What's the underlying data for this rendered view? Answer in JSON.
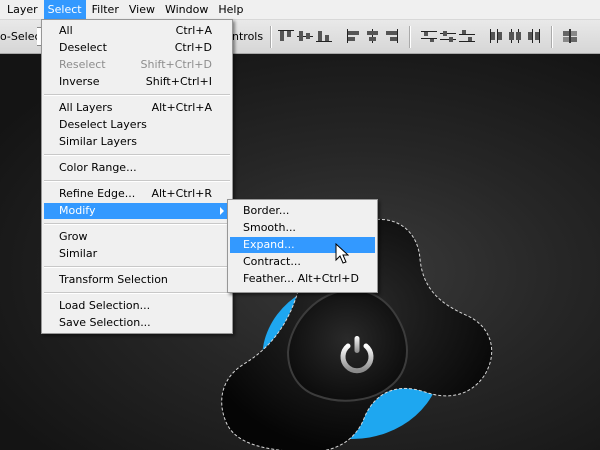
{
  "menubar": {
    "items": [
      "Layer",
      "Select",
      "Filter",
      "View",
      "Window",
      "Help"
    ],
    "active": "Select"
  },
  "options": {
    "autoselect_label": "o-Select:",
    "controls_label": "ntrols",
    "icons": [
      "align-top-icon",
      "align-vcenter-icon",
      "align-bottom-icon",
      "align-left-icon",
      "align-hcenter-icon",
      "align-right-icon",
      "distribute-top-icon",
      "distribute-vcenter-icon",
      "distribute-bottom-icon",
      "distribute-left-icon",
      "distribute-hcenter-icon",
      "distribute-right-icon",
      "auto-align-icon"
    ]
  },
  "select_menu": {
    "items": [
      {
        "label": "All",
        "shortcut": "Ctrl+A",
        "disabled": false
      },
      {
        "label": "Deselect",
        "shortcut": "Ctrl+D",
        "disabled": false
      },
      {
        "label": "Reselect",
        "shortcut": "Shift+Ctrl+D",
        "disabled": true
      },
      {
        "label": "Inverse",
        "shortcut": "Shift+Ctrl+I",
        "disabled": false
      },
      {
        "label": "All Layers",
        "shortcut": "Alt+Ctrl+A",
        "disabled": false
      },
      {
        "label": "Deselect Layers",
        "shortcut": "",
        "disabled": false
      },
      {
        "label": "Similar Layers",
        "shortcut": "",
        "disabled": false
      },
      {
        "label": "Color Range...",
        "shortcut": "",
        "disabled": false
      },
      {
        "label": "Refine Edge...",
        "shortcut": "Alt+Ctrl+R",
        "disabled": false
      },
      {
        "label": "Modify",
        "shortcut": "",
        "disabled": false,
        "submenu": true,
        "highlighted": true
      },
      {
        "label": "Grow",
        "shortcut": "",
        "disabled": false
      },
      {
        "label": "Similar",
        "shortcut": "",
        "disabled": false
      },
      {
        "label": "Transform Selection",
        "shortcut": "",
        "disabled": false
      },
      {
        "label": "Load Selection...",
        "shortcut": "",
        "disabled": false
      },
      {
        "label": "Save Selection...",
        "shortcut": "",
        "disabled": false
      }
    ]
  },
  "modify_submenu": {
    "items": [
      {
        "label": "Border...",
        "shortcut": ""
      },
      {
        "label": "Smooth...",
        "shortcut": ""
      },
      {
        "label": "Expand...",
        "shortcut": "",
        "highlighted": true
      },
      {
        "label": "Contract...",
        "shortcut": ""
      },
      {
        "label": "Feather...",
        "shortcut": "Alt+Ctrl+D"
      }
    ]
  },
  "colors": {
    "menu_highlight": "#3399ff",
    "accent_blue": "#1ea7f0",
    "disabled_text": "#8d8d8d"
  }
}
